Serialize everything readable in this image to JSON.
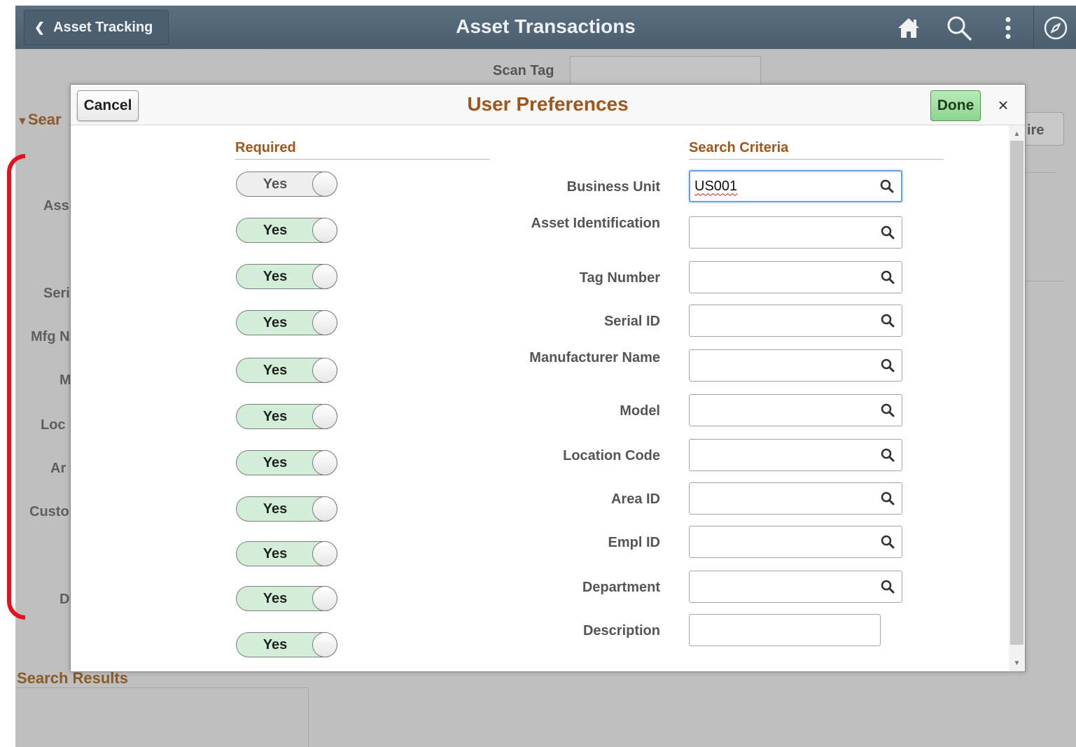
{
  "header": {
    "back_label": "Asset Tracking",
    "title": "Asset Transactions",
    "icons": [
      "home-icon",
      "search-icon",
      "more-actions-icon",
      "navbar-compass-icon"
    ]
  },
  "background": {
    "scan_tag_label": "Scan Tag",
    "section_label": "Sear",
    "button_fragment": "ire",
    "labels": [
      "Ass",
      "Seri",
      "Mfg N",
      "M",
      "Loc",
      "Ar",
      "Custo",
      "D"
    ],
    "results_label": "Search Results"
  },
  "modal": {
    "cancel_label": "Cancel",
    "title": "User Preferences",
    "done_label": "Done",
    "close_glyph": "×",
    "required_header": "Required",
    "criteria_header": "Search Criteria",
    "toggles": [
      {
        "label": "Yes",
        "state": "off"
      },
      {
        "label": "Yes",
        "state": "on"
      },
      {
        "label": "Yes",
        "state": "on"
      },
      {
        "label": "Yes",
        "state": "on"
      },
      {
        "label": "Yes",
        "state": "on"
      },
      {
        "label": "Yes",
        "state": "on"
      },
      {
        "label": "Yes",
        "state": "on"
      },
      {
        "label": "Yes",
        "state": "on"
      },
      {
        "label": "Yes",
        "state": "on"
      },
      {
        "label": "Yes",
        "state": "on"
      },
      {
        "label": "Yes",
        "state": "on"
      }
    ],
    "fields": [
      {
        "label": "Business Unit",
        "value": "US001"
      },
      {
        "label": "Asset Identification",
        "value": ""
      },
      {
        "label": "Tag Number",
        "value": ""
      },
      {
        "label": "Serial ID",
        "value": ""
      },
      {
        "label": "Manufacturer Name",
        "value": ""
      },
      {
        "label": "Model",
        "value": ""
      },
      {
        "label": "Location Code",
        "value": ""
      },
      {
        "label": "Area ID",
        "value": ""
      },
      {
        "label": "Empl ID",
        "value": ""
      },
      {
        "label": "Department",
        "value": ""
      },
      {
        "label": "Description",
        "value": ""
      }
    ]
  },
  "colors": {
    "header_bg": "#4a5e6f",
    "accent_brown": "#a0551a",
    "toggle_on": "#d2eed8",
    "done_green": "#8fd38f",
    "focus_blue": "#6a9ee8"
  }
}
